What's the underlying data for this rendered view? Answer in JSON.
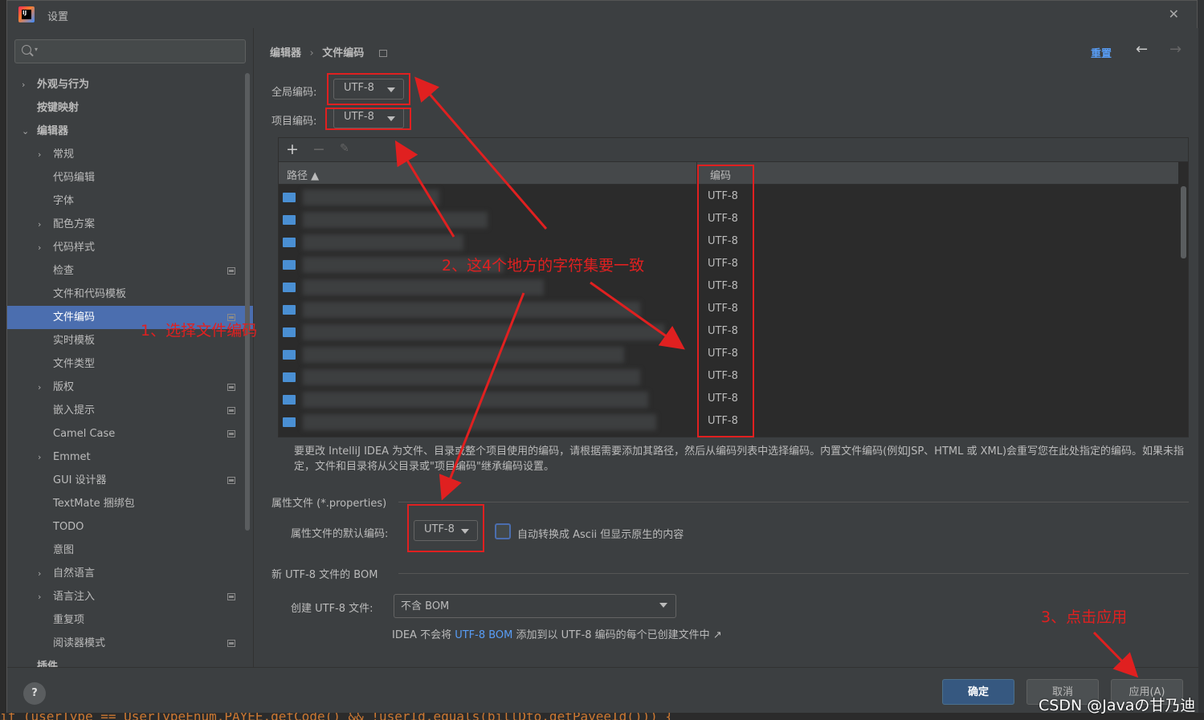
{
  "window": {
    "title": "设置"
  },
  "search": {
    "placeholder": ""
  },
  "sidebar": {
    "items": [
      {
        "label": "外观与行为",
        "chevron": "›",
        "bold": true
      },
      {
        "label": "按键映射",
        "chevron": "",
        "bold": true
      },
      {
        "label": "编辑器",
        "chevron": "⌄",
        "bold": true
      },
      {
        "label": "常规",
        "chevron": "›"
      },
      {
        "label": "代码编辑",
        "chevron": ""
      },
      {
        "label": "字体",
        "chevron": ""
      },
      {
        "label": "配色方案",
        "chevron": "›"
      },
      {
        "label": "代码样式",
        "chevron": "›"
      },
      {
        "label": "检查",
        "chevron": "",
        "proj": true
      },
      {
        "label": "文件和代码模板",
        "chevron": ""
      },
      {
        "label": "文件编码",
        "chevron": "",
        "proj": true,
        "selected": true
      },
      {
        "label": "实时模板",
        "chevron": ""
      },
      {
        "label": "文件类型",
        "chevron": ""
      },
      {
        "label": "版权",
        "chevron": "›",
        "proj": true
      },
      {
        "label": "嵌入提示",
        "chevron": "",
        "proj": true
      },
      {
        "label": "Camel Case",
        "chevron": "",
        "proj": true
      },
      {
        "label": "Emmet",
        "chevron": "›"
      },
      {
        "label": "GUI 设计器",
        "chevron": "",
        "proj": true
      },
      {
        "label": "TextMate 捆绑包",
        "chevron": ""
      },
      {
        "label": "TODO",
        "chevron": ""
      },
      {
        "label": "意图",
        "chevron": ""
      },
      {
        "label": "自然语言",
        "chevron": "›"
      },
      {
        "label": "语言注入",
        "chevron": "›",
        "proj": true
      },
      {
        "label": "重复项",
        "chevron": ""
      },
      {
        "label": "阅读器模式",
        "chevron": "",
        "proj": true
      },
      {
        "label": "插件",
        "chevron": "",
        "bold": true
      }
    ]
  },
  "breadcrumb": {
    "parent": "编辑器",
    "current": "文件编码"
  },
  "header": {
    "reset_label": "重置"
  },
  "global_encoding": {
    "label": "全局编码:",
    "value": "UTF-8"
  },
  "project_encoding": {
    "label": "项目编码:",
    "value": "UTF-8"
  },
  "table": {
    "col_path": "路径",
    "col_encoding": "编码",
    "rows": [
      "UTF-8",
      "UTF-8",
      "UTF-8",
      "UTF-8",
      "UTF-8",
      "UTF-8",
      "UTF-8",
      "UTF-8",
      "UTF-8",
      "UTF-8",
      "UTF-8"
    ]
  },
  "description": "要更改 IntelliJ IDEA 为文件、目录或整个项目使用的编码，请根据需要添加其路径，然后从编码列表中选择编码。内置文件编码(例如JSP、HTML 或 XML)会重写您在此处指定的编码。如果未指定，文件和目录将从父目录或\"项目编码\"继承编码设置。",
  "properties": {
    "section": "属性文件 (*.properties)",
    "label": "属性文件的默认编码:",
    "value": "UTF-8",
    "checkbox_label": "自动转换成 Ascii 但显示原生的内容"
  },
  "bom": {
    "section": "新 UTF-8 文件的 BOM",
    "label": "创建 UTF-8 文件:",
    "value": "不含 BOM",
    "note_prefix": "IDEA 不会将 ",
    "note_link": "UTF-8 BOM",
    "note_suffix": " 添加到以 UTF-8 编码的每个已创建文件中 ↗"
  },
  "annotations": {
    "step1": "1、选择文件编码",
    "step2": "2、这4个地方的字符集要一致",
    "step3": "3、点击应用"
  },
  "footer": {
    "help": "?",
    "ok_label": "确定",
    "cancel_label": "取消",
    "apply_label": "应用(A)"
  },
  "code_line": "if (userType == UserTypeEnum.PAYEE.getCode() && !userId.equals(billDto.getPayeeId())) {",
  "watermark": "CSDN @Javaの甘乃迪",
  "colors": {
    "accent": "#4b6eaf",
    "link": "#589df6",
    "annotation": "#e02020"
  }
}
